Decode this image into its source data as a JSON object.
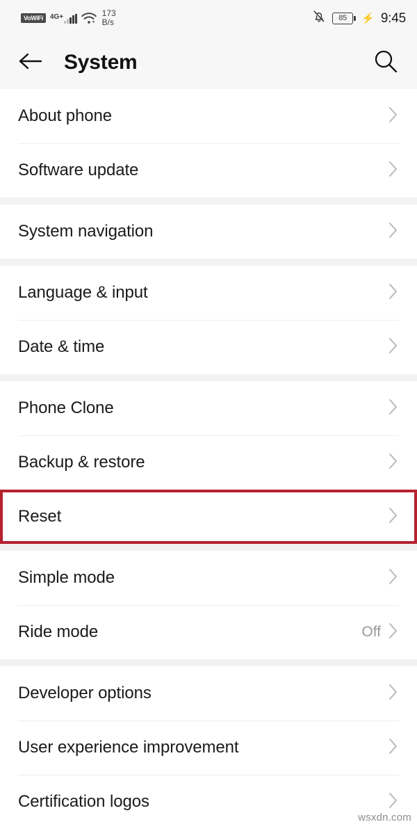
{
  "status_bar": {
    "vowifi_label": "VoWiFi",
    "network_type": "4G",
    "network_plus": "+",
    "data_rate_value": "173",
    "data_rate_unit": "B/s",
    "battery_percent": "85",
    "time": "9:45",
    "icons": {
      "signal": "signal-bars-icon",
      "wifi": "wifi-icon",
      "mute": "bell-slash-icon",
      "charging": "charging-bolt-icon"
    }
  },
  "header": {
    "title": "System",
    "back_icon": "back-arrow-icon",
    "search_icon": "search-icon"
  },
  "groups": [
    {
      "rows": [
        {
          "label": "About phone",
          "value": "",
          "highlighted": false
        },
        {
          "label": "Software update",
          "value": "",
          "highlighted": false
        }
      ]
    },
    {
      "rows": [
        {
          "label": "System navigation",
          "value": "",
          "highlighted": false
        }
      ]
    },
    {
      "rows": [
        {
          "label": "Language & input",
          "value": "",
          "highlighted": false
        },
        {
          "label": "Date & time",
          "value": "",
          "highlighted": false
        }
      ]
    },
    {
      "rows": [
        {
          "label": "Phone Clone",
          "value": "",
          "highlighted": false
        },
        {
          "label": "Backup & restore",
          "value": "",
          "highlighted": false
        },
        {
          "label": "Reset",
          "value": "",
          "highlighted": true
        }
      ]
    },
    {
      "rows": [
        {
          "label": "Simple mode",
          "value": "",
          "highlighted": false
        },
        {
          "label": "Ride mode",
          "value": "Off",
          "highlighted": false
        }
      ]
    },
    {
      "rows": [
        {
          "label": "Developer options",
          "value": "",
          "highlighted": false
        },
        {
          "label": "User experience improvement",
          "value": "",
          "highlighted": false
        },
        {
          "label": "Certification logos",
          "value": "",
          "highlighted": false
        }
      ]
    }
  ],
  "highlight_color": "#b52230",
  "watermark": "wsxdn.com"
}
